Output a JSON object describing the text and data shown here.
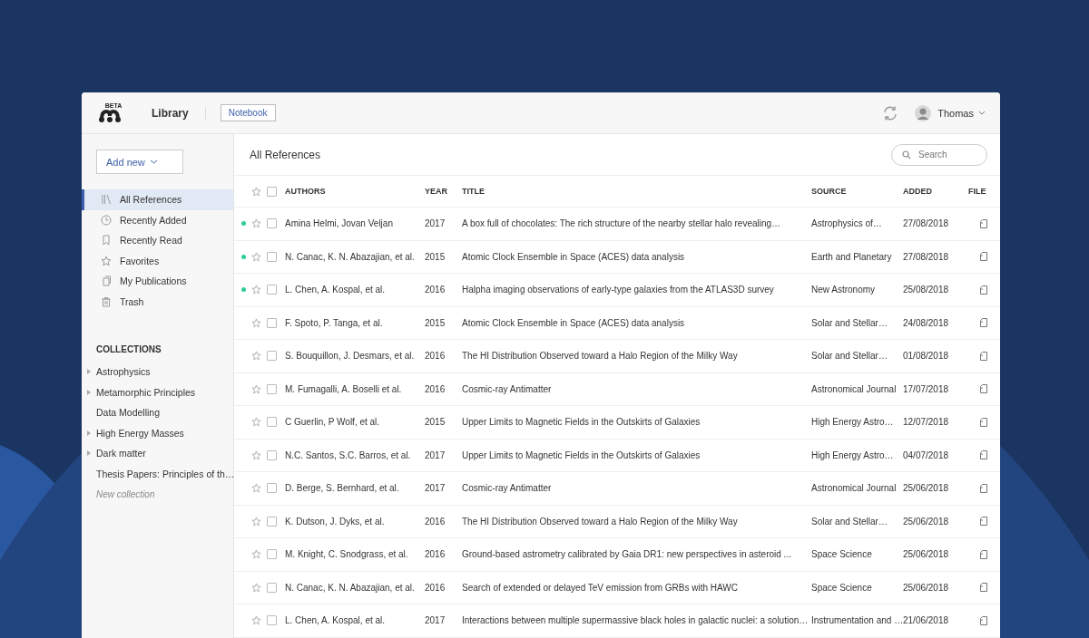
{
  "header": {
    "badge": "BETA",
    "section": "Library",
    "notebook": "Notebook",
    "user": "Thomas"
  },
  "sidebar": {
    "add_new": "Add new",
    "items": [
      {
        "label": "All References",
        "selected": true
      },
      {
        "label": "Recently Added",
        "selected": false
      },
      {
        "label": "Recently Read",
        "selected": false
      },
      {
        "label": "Favorites",
        "selected": false
      },
      {
        "label": "My Publications",
        "selected": false
      },
      {
        "label": "Trash",
        "selected": false
      }
    ],
    "collections_heading": "COLLECTIONS",
    "collections": [
      {
        "label": "Astrophysics",
        "expandable": true
      },
      {
        "label": "Metamorphic Principles",
        "expandable": true
      },
      {
        "label": "Data Modelling",
        "expandable": false
      },
      {
        "label": "High Energy Masses",
        "expandable": true
      },
      {
        "label": "Dark matter",
        "expandable": true
      },
      {
        "label": "Thesis Papers: Principles of th…",
        "expandable": false
      }
    ],
    "new_collection": "New collection"
  },
  "main": {
    "title": "All References",
    "search": {
      "placeholder": "Search"
    }
  },
  "table": {
    "columns": [
      "AUTHORS",
      "YEAR",
      "TITLE",
      "SOURCE",
      "ADDED",
      "FILE"
    ],
    "select_all_checked": false,
    "rows": [
      {
        "unread": true,
        "starred": false,
        "checked": false,
        "authors": "Amina Helmi, Jovan Veljan",
        "year": "2017",
        "title": "A box full of chocolates: The rich structure of the nearby stellar halo revealing…",
        "source": "Astrophysics of…",
        "added": "27/08/2018"
      },
      {
        "unread": true,
        "starred": false,
        "checked": false,
        "authors": "N. Canac, K. N. Abazajian, et al.",
        "year": "2015",
        "title": "Atomic Clock Ensemble in Space (ACES) data analysis",
        "source": "Earth and Planetary",
        "added": "27/08/2018"
      },
      {
        "unread": true,
        "starred": false,
        "checked": false,
        "authors": "L. Chen, A. Kospal, et al.",
        "year": "2016",
        "title": "Halpha imaging observations of early-type galaxies from the ATLAS3D survey",
        "source": "New Astronomy",
        "added": "25/08/2018"
      },
      {
        "unread": false,
        "starred": false,
        "checked": false,
        "authors": "F. Spoto, P. Tanga, et al.",
        "year": "2015",
        "title": "Atomic Clock Ensemble in Space (ACES) data analysis",
        "source": "Solar and Stellar…",
        "added": "24/08/2018"
      },
      {
        "unread": false,
        "starred": false,
        "checked": false,
        "authors": "S. Bouquillon, J. Desmars, et al.",
        "year": "2016",
        "title": "The HI Distribution Observed toward a Halo Region of the Milky Way",
        "source": "Solar and Stellar…",
        "added": "01/08/2018"
      },
      {
        "unread": false,
        "starred": false,
        "checked": false,
        "authors": "M. Fumagalli, A. Boselli et al.",
        "year": "2016",
        "title": "Cosmic-ray Antimatter",
        "source": "Astronomical Journal",
        "added": "17/07/2018"
      },
      {
        "unread": false,
        "starred": false,
        "checked": false,
        "authors": "C Guerlin, P Wolf, et al.",
        "year": "2015",
        "title": "Upper Limits to Magnetic Fields in the Outskirts of Galaxies",
        "source": "High Energy Astro…",
        "added": "12/07/2018"
      },
      {
        "unread": false,
        "starred": false,
        "checked": false,
        "authors": "N.C. Santos, S.C. Barros, et al.",
        "year": "2017",
        "title": "Upper Limits to Magnetic Fields in the Outskirts of Galaxies",
        "source": "High Energy Astro…",
        "added": "04/07/2018"
      },
      {
        "unread": false,
        "starred": false,
        "checked": false,
        "authors": "D. Berge, S. Bernhard, et al.",
        "year": "2017",
        "title": "Cosmic-ray Antimatter",
        "source": "Astronomical Journal",
        "added": "25/06/2018"
      },
      {
        "unread": false,
        "starred": false,
        "checked": false,
        "authors": "K. Dutson, J. Dyks, et al.",
        "year": "2016",
        "title": "The HI Distribution Observed toward a Halo Region of the Milky Way",
        "source": "Solar and Stellar…",
        "added": "25/06/2018"
      },
      {
        "unread": false,
        "starred": false,
        "checked": false,
        "authors": "M. Knight, C. Snodgrass, et al.",
        "year": "2016",
        "title": "Ground-based astrometry calibrated by Gaia DR1: new perspectives in asteroid ...",
        "source": "Space Science",
        "added": "25/06/2018"
      },
      {
        "unread": false,
        "starred": false,
        "checked": false,
        "authors": "N. Canac, K. N. Abazajian, et al.",
        "year": "2016",
        "title": "Search of extended or delayed TeV emission from GRBs with HAWC",
        "source": "Space Science",
        "added": "25/06/2018"
      },
      {
        "unread": false,
        "starred": false,
        "checked": false,
        "authors": "L. Chen, A. Kospal, et al.",
        "year": "2017",
        "title": "Interactions between multiple supermassive black holes in galactic nuclei: a solution…",
        "source": "Instrumentation and …",
        "added": "21/06/2018"
      }
    ]
  }
}
